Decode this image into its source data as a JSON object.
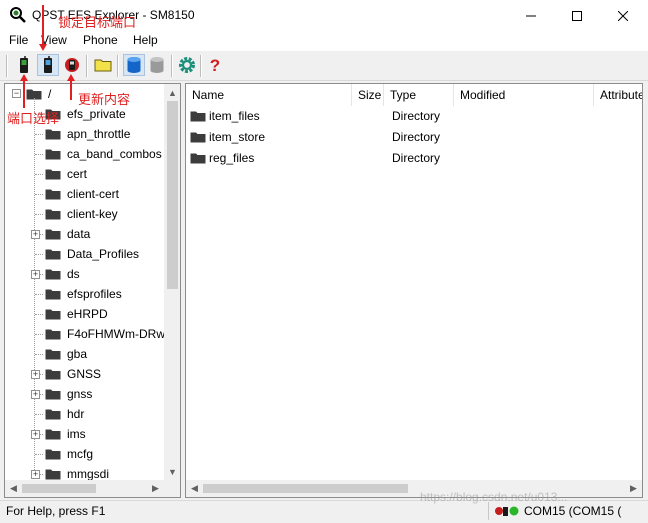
{
  "window": {
    "title": "QPST EFS Explorer - SM8150",
    "minimize_icon": "minimize-icon",
    "maximize_icon": "maximize-icon",
    "close_icon": "close-icon"
  },
  "menu": {
    "file": "File",
    "view": "View",
    "phone": "Phone",
    "help": "Help"
  },
  "toolbar": {
    "icons": [
      "phone-select-icon",
      "phone-lock-icon",
      "refresh-icon",
      "folder-icon",
      "database-icon",
      "database-gray-icon",
      "settings-gear-icon",
      "help-question-icon"
    ]
  },
  "tree": {
    "root": "/",
    "items": [
      {
        "label": "efs_private",
        "expandable": false
      },
      {
        "label": "apn_throttle",
        "expandable": false
      },
      {
        "label": "ca_band_combos",
        "expandable": false
      },
      {
        "label": "cert",
        "expandable": false
      },
      {
        "label": "client-cert",
        "expandable": false
      },
      {
        "label": "client-key",
        "expandable": false
      },
      {
        "label": "data",
        "expandable": true
      },
      {
        "label": "Data_Profiles",
        "expandable": false
      },
      {
        "label": "ds",
        "expandable": true
      },
      {
        "label": "efsprofiles",
        "expandable": false
      },
      {
        "label": "eHRPD",
        "expandable": false
      },
      {
        "label": "F4oFHMWm-DRw",
        "expandable": false
      },
      {
        "label": "gba",
        "expandable": false
      },
      {
        "label": "GNSS",
        "expandable": true
      },
      {
        "label": "gnss",
        "expandable": true
      },
      {
        "label": "hdr",
        "expandable": false
      },
      {
        "label": "ims",
        "expandable": true
      },
      {
        "label": "mcfg",
        "expandable": false
      },
      {
        "label": "mmgsdi",
        "expandable": true
      }
    ]
  },
  "list": {
    "columns": [
      "Name",
      "Size",
      "Type",
      "Modified",
      "Attributes"
    ],
    "rows": [
      {
        "name": "item_files",
        "size": "",
        "type": "Directory",
        "modified": "",
        "attributes": ""
      },
      {
        "name": "item_store",
        "size": "",
        "type": "Directory",
        "modified": "",
        "attributes": ""
      },
      {
        "name": "reg_files",
        "size": "",
        "type": "Directory",
        "modified": "",
        "attributes": ""
      }
    ]
  },
  "status": {
    "help_text": "For Help, press F1",
    "port_text": "COM15 (COM15 (",
    "port_icon": "phone-status-icon"
  },
  "annotations": {
    "select_port": "端口选择",
    "lock_port": "锁定目标端口",
    "refresh": "更新内容"
  },
  "watermark": {
    "text": "https://blog.csdn.net/u013..."
  },
  "colors": {
    "annotation": "#e02020",
    "selected_button": "#d7e6f5",
    "window_bg": "#f0f0f0"
  }
}
